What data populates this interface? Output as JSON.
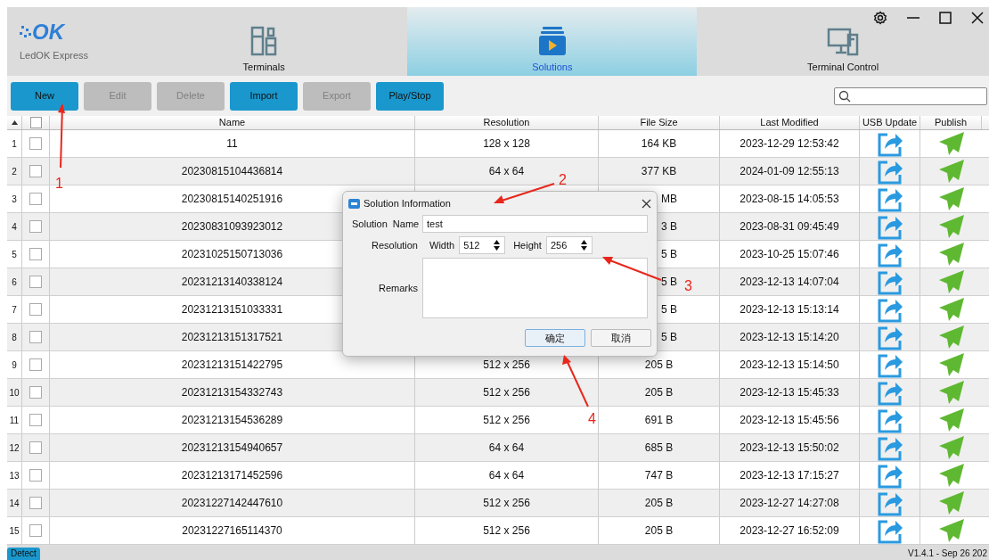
{
  "app": {
    "logo": "OK",
    "name": "LedOK Express"
  },
  "tabs": [
    {
      "label": "Terminals",
      "kind": "terminals",
      "selected": false
    },
    {
      "label": "Solutions",
      "kind": "solutions",
      "selected": true
    },
    {
      "label": "Terminal Control",
      "kind": "control",
      "selected": false
    }
  ],
  "toolbar": {
    "buttons": [
      {
        "label": "New",
        "disabled": false
      },
      {
        "label": "Edit",
        "disabled": true
      },
      {
        "label": "Delete",
        "disabled": true
      },
      {
        "label": "Import",
        "disabled": false
      },
      {
        "label": "Export",
        "disabled": true
      },
      {
        "label": "Play/Stop",
        "disabled": false
      }
    ]
  },
  "table": {
    "all_checked": false,
    "columns": [
      "Name",
      "Resolution",
      "File Size",
      "Last Modified",
      "USB Update",
      "Publish"
    ],
    "rows": [
      {
        "index": "1",
        "checked": false,
        "name": "11",
        "resolution": "128 x 128",
        "file_size": "164 KB",
        "last_modified": "2023-12-29 12:53:42"
      },
      {
        "index": "2",
        "checked": false,
        "name": "20230815104436814",
        "resolution": "64 x 64",
        "file_size": "377 KB",
        "last_modified": "2024-01-09 12:55:13"
      },
      {
        "index": "3",
        "checked": false,
        "name": "20230815140251916",
        "file_size": "MB",
        "last_modified": "2023-08-15 14:05:53"
      },
      {
        "index": "4",
        "checked": false,
        "name": "20230831093923012",
        "file_size": "3 B",
        "last_modified": "2023-08-31 09:45:49"
      },
      {
        "index": "5",
        "checked": false,
        "name": "20231025150713036",
        "file_size": "5 B",
        "last_modified": "2023-10-25 15:07:46"
      },
      {
        "index": "6",
        "checked": false,
        "name": "20231213140338124",
        "file_size": "5 B",
        "last_modified": "2023-12-13 14:07:04"
      },
      {
        "index": "7",
        "checked": false,
        "name": "20231213151033331",
        "file_size": "5 B",
        "last_modified": "2023-12-13 15:13:14"
      },
      {
        "index": "8",
        "checked": false,
        "name": "20231213151317521",
        "file_size": "5 B",
        "last_modified": "2023-12-13 15:14:20"
      },
      {
        "index": "9",
        "checked": false,
        "name": "20231213151422795",
        "resolution": "512 x 256",
        "file_size": "205 B",
        "last_modified": "2023-12-13 15:14:50"
      },
      {
        "index": "10",
        "checked": false,
        "name": "20231213154332743",
        "resolution": "512 x 256",
        "file_size": "205 B",
        "last_modified": "2023-12-13 15:45:33"
      },
      {
        "index": "11",
        "checked": false,
        "name": "20231213154536289",
        "resolution": "512 x 256",
        "file_size": "691 B",
        "last_modified": "2023-12-13 15:45:56"
      },
      {
        "index": "12",
        "checked": false,
        "name": "20231213154940657",
        "resolution": "64 x 64",
        "file_size": "685 B",
        "last_modified": "2023-12-13 15:50:02"
      },
      {
        "index": "13",
        "checked": false,
        "name": "20231213171452596",
        "resolution": "64 x 64",
        "file_size": "747 B",
        "last_modified": "2023-12-13 17:15:27"
      },
      {
        "index": "14",
        "checked": false,
        "name": "20231227142447610",
        "resolution": "512 x 256",
        "file_size": "205 B",
        "last_modified": "2023-12-27 14:27:08"
      },
      {
        "index": "15",
        "checked": false,
        "name": "20231227165114370",
        "resolution": "512 x 256",
        "file_size": "205 B",
        "last_modified": "2023-12-27 16:52:09"
      }
    ]
  },
  "status_bar": {
    "button": "Detect",
    "version": "V1.4.1 - Sep 26 202"
  },
  "dialog": {
    "title": "Solution Information",
    "name_label": "Solution  Name",
    "name_value": "test",
    "resolution_label": "Resolution",
    "width_label": "Width",
    "width_value": "512",
    "height_label": "Height",
    "height_value": "256",
    "remarks_label": "Remarks",
    "ok": "确定",
    "cancel": "取消"
  },
  "annotations": [
    {
      "label": "1"
    },
    {
      "label": "2"
    },
    {
      "label": "3"
    },
    {
      "label": "4"
    }
  ]
}
